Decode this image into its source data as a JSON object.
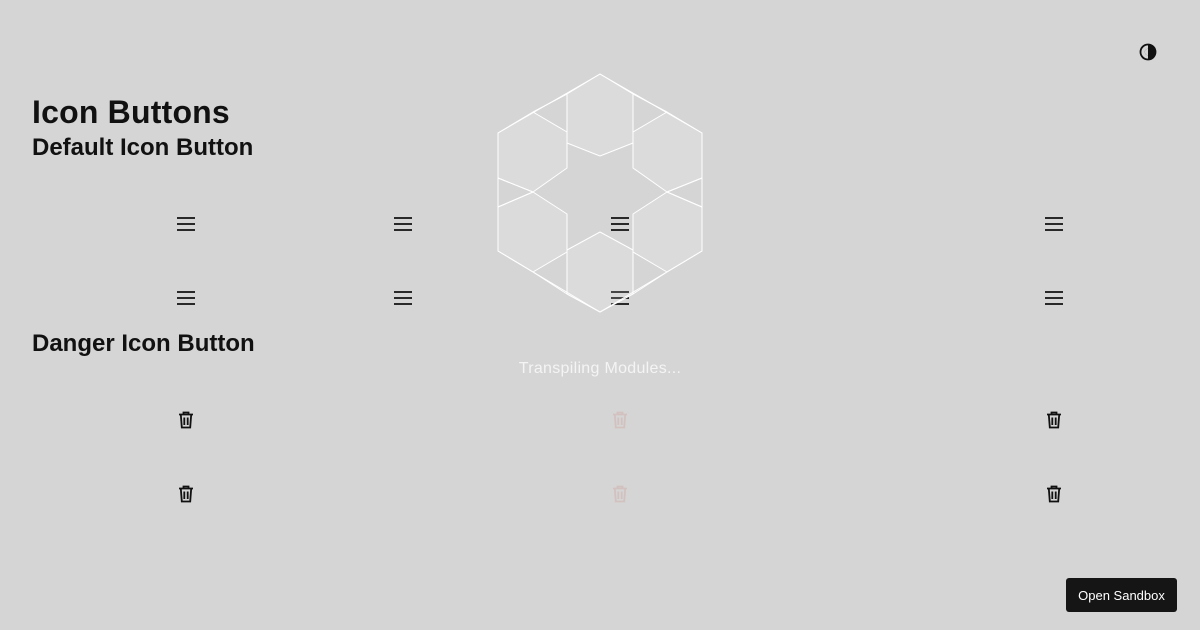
{
  "page": {
    "title": "Icon Buttons"
  },
  "sections": {
    "default": {
      "title": "Default Icon Button",
      "icon": "menu-icon"
    },
    "danger": {
      "title": "Danger Icon Button",
      "icon": "trash-icon"
    }
  },
  "theme_toggle": {
    "icon": "contrast-icon"
  },
  "loading": {
    "text": "Transpiling Modules..."
  },
  "footer": {
    "open_sandbox_label": "Open Sandbox"
  },
  "colors": {
    "background": "#d5d5d5",
    "text": "#111111",
    "sandbox_button": "#151515",
    "loader_stroke": "#ffffff"
  }
}
